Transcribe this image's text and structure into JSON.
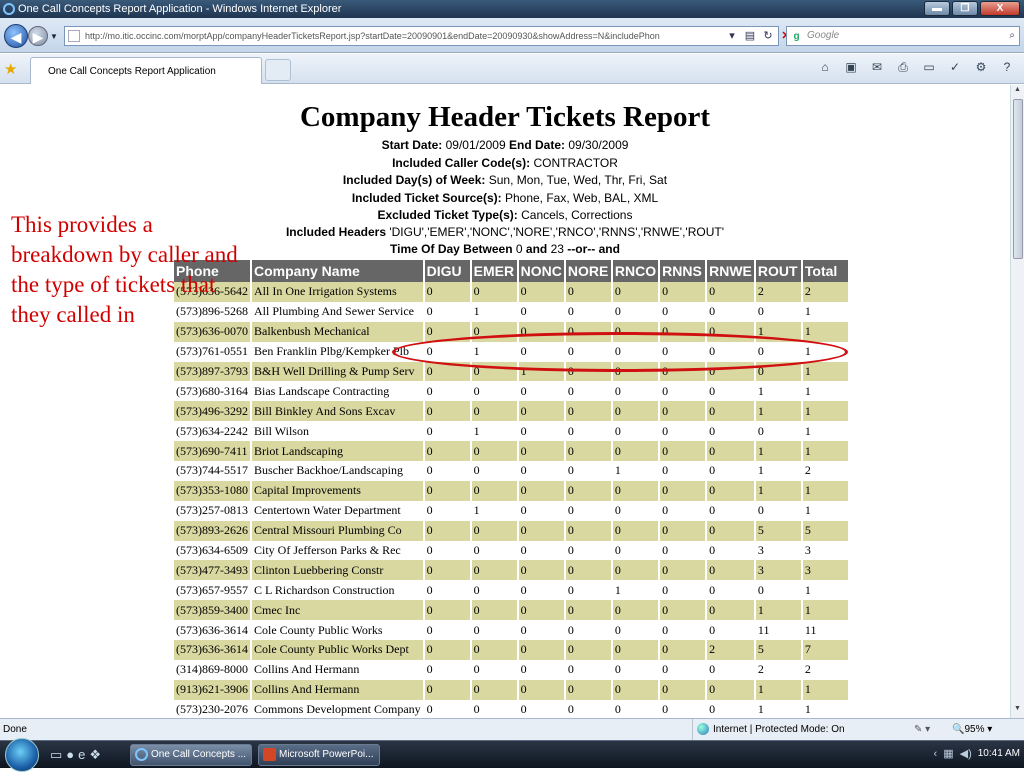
{
  "window": {
    "title": "One Call Concepts Report Application - Windows Internet Explorer",
    "controls": {
      "minimize": "▬",
      "maximize": "❐",
      "close": "X"
    }
  },
  "toolbar": {
    "back": "◀",
    "forward": "▶",
    "address": "http://mo.itic.occinc.com/morptApp/companyHeaderTicketsReport.jsp?startDate=20090901&endDate=20090930&showAddress=N&includePhon",
    "search_placeholder": "Google"
  },
  "tab": {
    "label": "One Call Concepts Report Application"
  },
  "report": {
    "title": "Company Header Tickets Report",
    "start_label": "Start Date:",
    "start_value": "09/01/2009",
    "end_label": "End Date:",
    "end_value": "09/30/2009",
    "caller_label": "Included Caller Code(s):",
    "caller_value": "CONTRACTOR",
    "days_label": "Included Day(s) of Week:",
    "days_value": "Sun, Mon, Tue, Wed, Thr, Fri, Sat",
    "source_label": "Included Ticket Source(s):",
    "source_value": "Phone, Fax, Web, BAL, XML",
    "excluded_label": "Excluded Ticket Type(s):",
    "excluded_value": "Cancels, Corrections",
    "headers_label": "Included Headers",
    "headers_value": "'DIGU','EMER','NONC','NORE','RNCO','RNNS','RNWE','ROUT'",
    "time_prefix": "Time Of Day Between",
    "time_start": "0",
    "time_and": "and",
    "time_end": "23",
    "time_suffix": "--or-- and"
  },
  "annotation": "This provides a breakdown by caller and the type of tickets that they called in",
  "table": {
    "columns": [
      "Phone",
      "Company Name",
      "DIGU",
      "EMER",
      "NONC",
      "NORE",
      "RNCO",
      "RNNS",
      "RNWE",
      "ROUT",
      "Total"
    ],
    "rows": [
      [
        "(573)636-5642",
        "All In One Irrigation Systems",
        "0",
        "0",
        "0",
        "0",
        "0",
        "0",
        "0",
        "2",
        "2"
      ],
      [
        "(573)896-5268",
        "All Plumbing And Sewer Service",
        "0",
        "1",
        "0",
        "0",
        "0",
        "0",
        "0",
        "0",
        "1"
      ],
      [
        "(573)636-0070",
        "Balkenbush Mechanical",
        "0",
        "0",
        "0",
        "0",
        "0",
        "0",
        "0",
        "1",
        "1"
      ],
      [
        "(573)761-0551",
        "Ben Franklin Plbg/Kempker Plb",
        "0",
        "1",
        "0",
        "0",
        "0",
        "0",
        "0",
        "0",
        "1"
      ],
      [
        "(573)897-3793",
        "B&H Well Drilling & Pump Serv",
        "0",
        "0",
        "1",
        "0",
        "0",
        "0",
        "0",
        "0",
        "1"
      ],
      [
        "(573)680-3164",
        "Bias Landscape Contracting",
        "0",
        "0",
        "0",
        "0",
        "0",
        "0",
        "0",
        "1",
        "1"
      ],
      [
        "(573)496-3292",
        "Bill Binkley And Sons Excav",
        "0",
        "0",
        "0",
        "0",
        "0",
        "0",
        "0",
        "1",
        "1"
      ],
      [
        "(573)634-2242",
        "Bill Wilson",
        "0",
        "1",
        "0",
        "0",
        "0",
        "0",
        "0",
        "0",
        "1"
      ],
      [
        "(573)690-7411",
        "Briot Landscaping",
        "0",
        "0",
        "0",
        "0",
        "0",
        "0",
        "0",
        "1",
        "1"
      ],
      [
        "(573)744-5517",
        "Buscher Backhoe/Landscaping",
        "0",
        "0",
        "0",
        "0",
        "1",
        "0",
        "0",
        "1",
        "2"
      ],
      [
        "(573)353-1080",
        "Capital Improvements",
        "0",
        "0",
        "0",
        "0",
        "0",
        "0",
        "0",
        "1",
        "1"
      ],
      [
        "(573)257-0813",
        "Centertown Water Department",
        "0",
        "1",
        "0",
        "0",
        "0",
        "0",
        "0",
        "0",
        "1"
      ],
      [
        "(573)893-2626",
        "Central Missouri Plumbing Co",
        "0",
        "0",
        "0",
        "0",
        "0",
        "0",
        "0",
        "5",
        "5"
      ],
      [
        "(573)634-6509",
        "City Of Jefferson Parks & Rec",
        "0",
        "0",
        "0",
        "0",
        "0",
        "0",
        "0",
        "3",
        "3"
      ],
      [
        "(573)477-3493",
        "Clinton Luebbering Constr",
        "0",
        "0",
        "0",
        "0",
        "0",
        "0",
        "0",
        "3",
        "3"
      ],
      [
        "(573)657-9557",
        "C L Richardson Construction",
        "0",
        "0",
        "0",
        "0",
        "1",
        "0",
        "0",
        "0",
        "1"
      ],
      [
        "(573)859-3400",
        "Cmec Inc",
        "0",
        "0",
        "0",
        "0",
        "0",
        "0",
        "0",
        "1",
        "1"
      ],
      [
        "(573)636-3614",
        "Cole County Public Works",
        "0",
        "0",
        "0",
        "0",
        "0",
        "0",
        "0",
        "11",
        "11"
      ],
      [
        "(573)636-3614",
        "Cole County Public Works Dept",
        "0",
        "0",
        "0",
        "0",
        "0",
        "0",
        "2",
        "5",
        "7"
      ],
      [
        "(314)869-8000",
        "Collins And Hermann",
        "0",
        "0",
        "0",
        "0",
        "0",
        "0",
        "0",
        "2",
        "2"
      ],
      [
        "(913)621-3906",
        "Collins And Hermann",
        "0",
        "0",
        "0",
        "0",
        "0",
        "0",
        "0",
        "1",
        "1"
      ],
      [
        "(573)230-2076",
        "Commons Development Company",
        "0",
        "0",
        "0",
        "0",
        "0",
        "0",
        "0",
        "1",
        "1"
      ]
    ]
  },
  "statusbar": {
    "status": "Done",
    "zone": "Internet | Protected Mode: On",
    "zoom": "95%"
  },
  "taskbar": {
    "ie_task": "One Call Concepts ...",
    "ppt_task": "Microsoft PowerPoi...",
    "clock": "10:41 AM"
  }
}
